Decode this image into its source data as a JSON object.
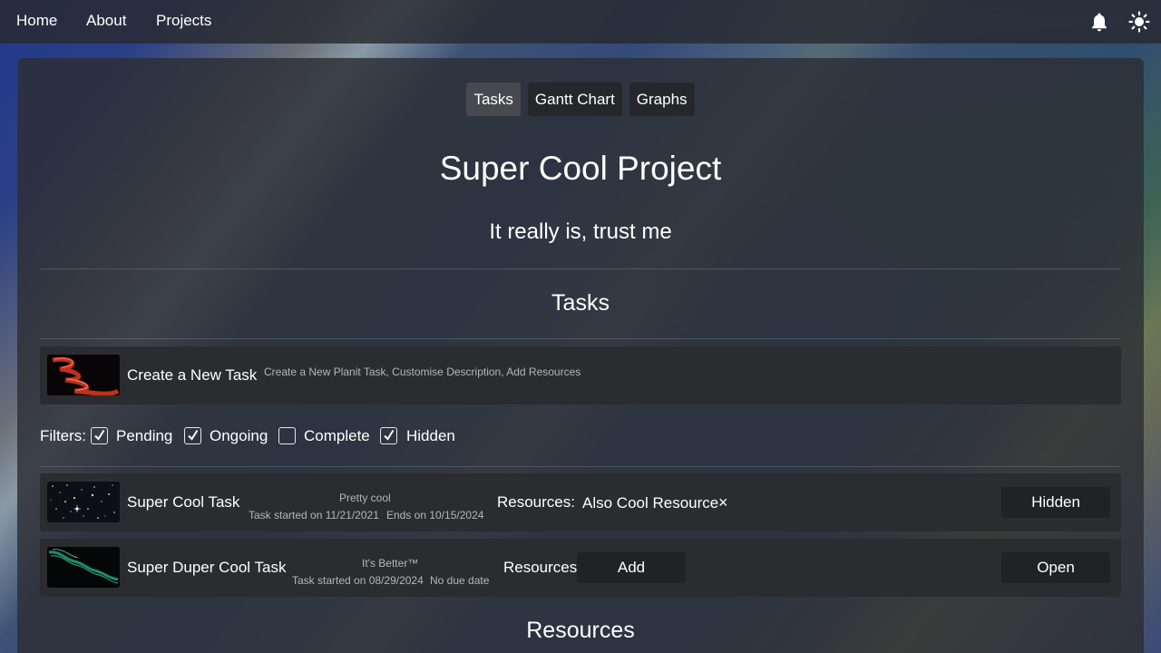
{
  "nav": {
    "links": [
      "Home",
      "About",
      "Projects"
    ],
    "icons": [
      "bell-icon",
      "sun-icon"
    ]
  },
  "tabs": [
    {
      "label": "Tasks",
      "active": true
    },
    {
      "label": "Gantt Chart",
      "active": false
    },
    {
      "label": "Graphs",
      "active": false
    }
  ],
  "project": {
    "title": "Super Cool Project",
    "subtitle": "It really is, trust me"
  },
  "tasks_section": {
    "heading": "Tasks",
    "create": {
      "title": "Create a New Task",
      "description": "Create a New Planit Task, Customise Description, Add Resources"
    },
    "filters": {
      "label": "Filters:",
      "items": [
        {
          "label": "Pending",
          "checked": true
        },
        {
          "label": "Ongoing",
          "checked": true
        },
        {
          "label": "Complete",
          "checked": false
        },
        {
          "label": "Hidden",
          "checked": true
        }
      ]
    },
    "tasks": [
      {
        "title": "Super Cool Task",
        "description": "Pretty cool",
        "started": "Task started on 11/21/2021",
        "ends": "Ends on 10/15/2024",
        "resources_label": "Resources:",
        "resource": "Also Cool Resource",
        "remove_symbol": "×",
        "status_button": "Hidden"
      },
      {
        "title": "Super Duper Cool Task",
        "description": "It's Better™",
        "started": "Task started on 08/29/2024",
        "ends": "No due date",
        "resources_label": "Resources:",
        "add_button": "Add",
        "status_button": "Open"
      }
    ]
  },
  "resources_section": {
    "heading": "Resources"
  }
}
